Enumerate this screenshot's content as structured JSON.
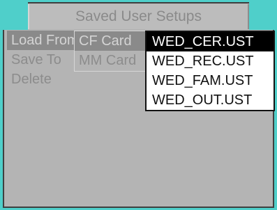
{
  "title": "Saved User Setups",
  "main_menu": [
    "Load From",
    "Save To",
    "Delete"
  ],
  "source_menu": [
    "CF Card",
    "MM Card"
  ],
  "files": [
    "WED_CER.UST",
    "WED_REC.UST",
    "WED_FAM.UST",
    "WED_OUT.UST"
  ]
}
